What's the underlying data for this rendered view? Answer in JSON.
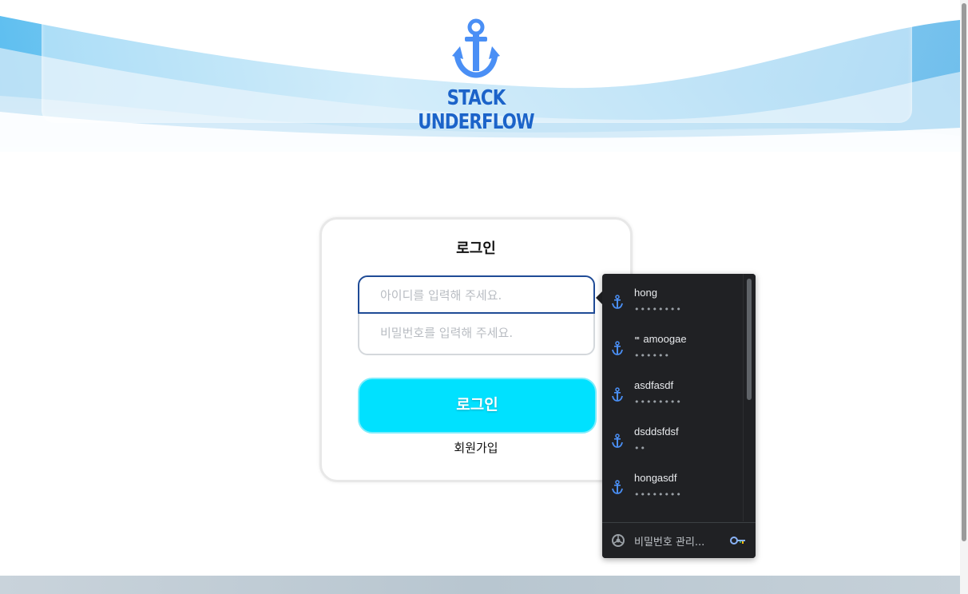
{
  "header": {
    "logo_text": "STACK UNDERFLOW"
  },
  "login": {
    "title": "로그인",
    "id_placeholder": "아이디를 입력해 주세요.",
    "password_placeholder": "비밀번호를 입력해 주세요.",
    "submit_label": "로그인",
    "signup_label": "회원가입"
  },
  "password_dropdown": {
    "items": [
      {
        "username": "hong",
        "masked": "••••••••",
        "icon": "anchor-icon"
      },
      {
        "username": "amoogae",
        "prefix": "ᄈ",
        "masked": "••••••",
        "icon": "anchor-icon"
      },
      {
        "username": "asdfasdf",
        "masked": "••••••••",
        "icon": "anchor-icon"
      },
      {
        "username": "dsddsfdsf",
        "masked": "••",
        "icon": "anchor-icon"
      },
      {
        "username": "hongasdf",
        "masked": "••••••••",
        "icon": "anchor-icon"
      }
    ],
    "manage_label": "비밀번호 관리...",
    "manage_icon": "chrome-icon",
    "key_icon": "key-icon"
  },
  "colors": {
    "login_button": "#00e1ff",
    "focus_border": "#1f4b96",
    "logo_blue": "#1b63c9",
    "dropdown_bg": "#202124"
  }
}
